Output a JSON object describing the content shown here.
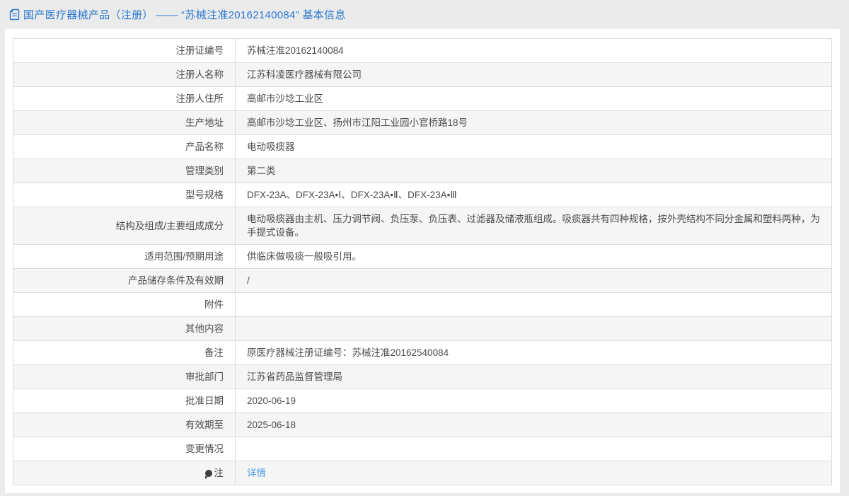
{
  "page": {
    "background_color": "#ebebeb",
    "accent_blue": "#2a79d0",
    "link_blue": "#4a9ce8",
    "stripe_color": "#f5f5f5"
  },
  "header": {
    "icon": "document-icon",
    "title": "国产医疗器械产品（注册） —— “苏械注准20162140084” 基本信息"
  },
  "table": {
    "rows": [
      {
        "label": "注册证编号",
        "value": "苏械注准20162140084"
      },
      {
        "label": "注册人名称",
        "value": "江苏科凌医疗器械有限公司"
      },
      {
        "label": "注册人住所",
        "value": "高邮市沙埝工业区"
      },
      {
        "label": "生产地址",
        "value": "高邮市沙埝工业区、扬州市江阳工业园小官桥路18号"
      },
      {
        "label": "产品名称",
        "value": "电动吸痰器"
      },
      {
        "label": "管理类别",
        "value": "第二类"
      },
      {
        "label": "型号规格",
        "value": "DFX-23A、DFX-23A•Ⅰ、DFX-23A•Ⅱ、DFX-23A•Ⅲ"
      },
      {
        "label": "结构及组成/主要组成成分",
        "value": "电动吸痰器由主机、压力调节阀、负压泵、负压表、过滤器及储液瓶组成。吸痰器共有四种规格，按外壳结构不同分金属和塑料两种，为手提式设备。"
      },
      {
        "label": "适用范围/预期用途",
        "value": "供临床做吸痰一般吸引用。"
      },
      {
        "label": "产品储存条件及有效期",
        "value": "/"
      },
      {
        "label": "附件",
        "value": ""
      },
      {
        "label": "其他内容",
        "value": ""
      },
      {
        "label": "备注",
        "value": "原医疗器械注册证编号：苏械注准20162540084"
      },
      {
        "label": "审批部门",
        "value": "江苏省药品监督管理局"
      },
      {
        "label": "批准日期",
        "value": "2020-06-19"
      },
      {
        "label": "有效期至",
        "value": "2025-06-18"
      },
      {
        "label": "变更情况",
        "value": ""
      },
      {
        "label": "注",
        "value": "详情",
        "icon": "note-icon",
        "value_is_link": true
      }
    ]
  }
}
